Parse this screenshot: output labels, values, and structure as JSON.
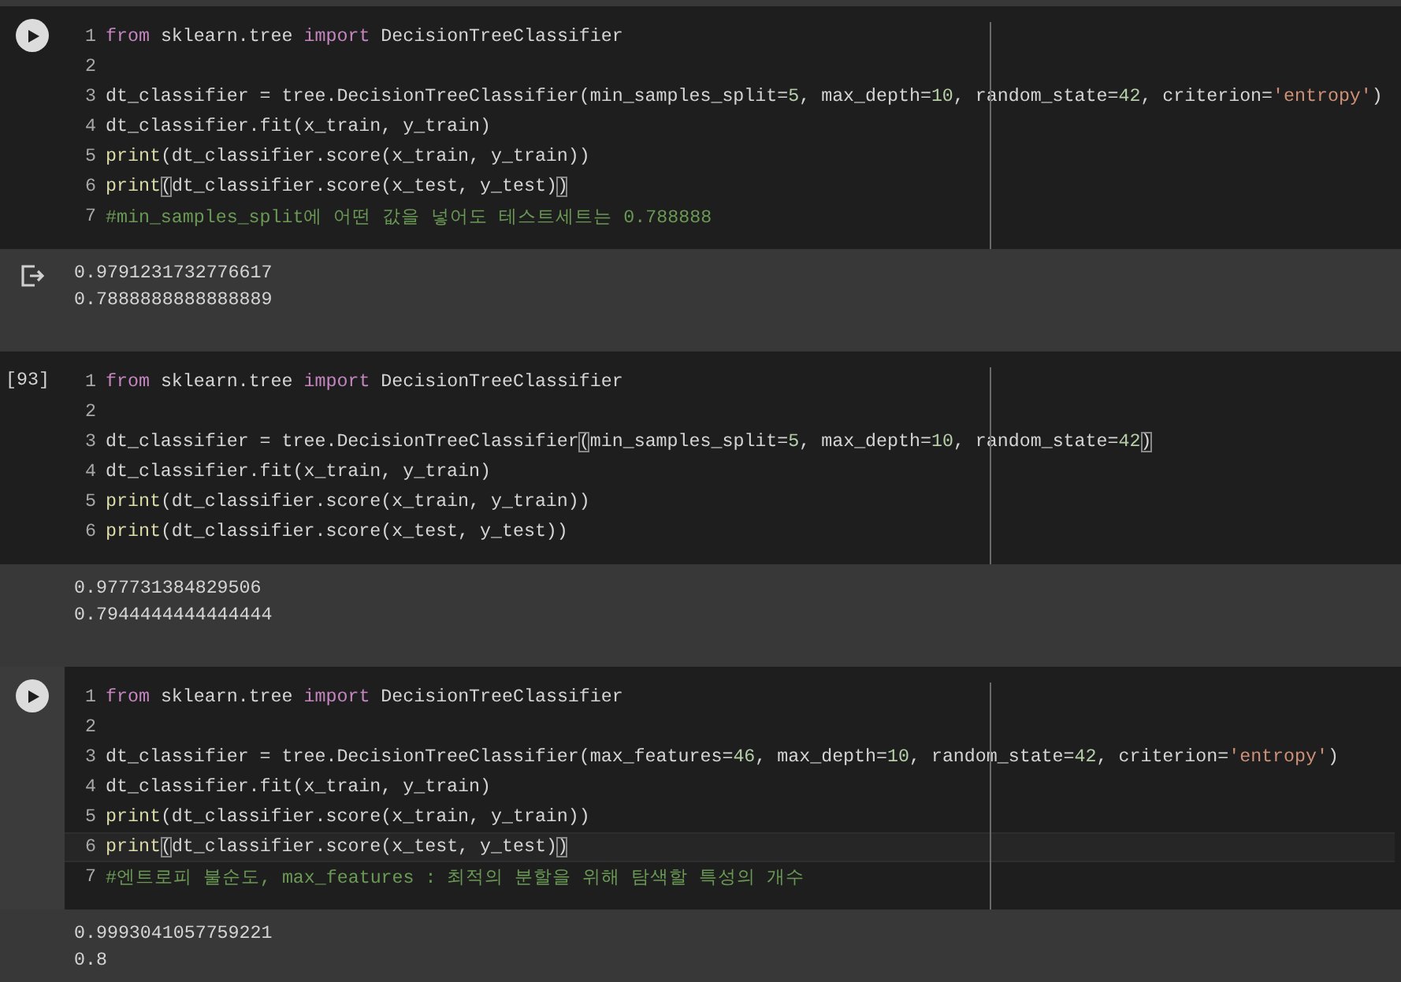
{
  "cells": [
    {
      "selected": false,
      "gutter": {
        "kind": "run"
      },
      "lines": [
        {
          "number": "1",
          "current": false,
          "tokens": [
            {
              "kind": "keyword",
              "text": "from"
            },
            {
              "kind": "plain",
              "text": " sklearn.tree "
            },
            {
              "kind": "keyword",
              "text": "import"
            },
            {
              "kind": "plain",
              "text": " DecisionTreeClassifier"
            }
          ]
        },
        {
          "number": "2",
          "current": false
        },
        {
          "number": "3",
          "current": false,
          "tokens": [
            {
              "kind": "plain",
              "text": "dt_classifier = tree.DecisionTreeClassifier(min_samples_split="
            },
            {
              "kind": "number",
              "text": "5"
            },
            {
              "kind": "plain",
              "text": ", max_depth="
            },
            {
              "kind": "number",
              "text": "10"
            },
            {
              "kind": "plain",
              "text": ", random_state="
            },
            {
              "kind": "number",
              "text": "42"
            },
            {
              "kind": "plain",
              "text": ", criterion="
            },
            {
              "kind": "string",
              "text": "'entropy'"
            },
            {
              "kind": "plain",
              "text": ")"
            }
          ]
        },
        {
          "number": "4",
          "current": false,
          "tokens": [
            {
              "kind": "plain",
              "text": "dt_classifier.fit(x_train, y_train)"
            }
          ]
        },
        {
          "number": "5",
          "current": false,
          "tokens": [
            {
              "kind": "builtin",
              "text": "print"
            },
            {
              "kind": "plain",
              "text": "(dt_classifier.score(x_train, y_train))"
            }
          ]
        },
        {
          "number": "6",
          "current": false,
          "tokens": [
            {
              "kind": "builtin",
              "text": "print"
            },
            {
              "kind": "match",
              "text": "("
            },
            {
              "kind": "plain",
              "text": "dt_classifier.score(x_test, y_test)"
            },
            {
              "kind": "match",
              "text": ")"
            }
          ]
        },
        {
          "number": "7",
          "current": false,
          "tokens": [
            {
              "kind": "comment",
              "text": "#min_samples_split에 어떤 값을 넣어도 테스트세트는 0.788888"
            }
          ]
        }
      ],
      "output": {
        "icon": true,
        "lines": [
          "0.9791231732776617",
          "0.7888888888888889"
        ]
      }
    },
    {
      "selected": false,
      "gutter": {
        "kind": "count",
        "label": "[93]"
      },
      "lines": [
        {
          "number": "1",
          "current": false,
          "tokens": [
            {
              "kind": "keyword",
              "text": "from"
            },
            {
              "kind": "plain",
              "text": " sklearn.tree "
            },
            {
              "kind": "keyword",
              "text": "import"
            },
            {
              "kind": "plain",
              "text": " DecisionTreeClassifier"
            }
          ]
        },
        {
          "number": "2",
          "current": false
        },
        {
          "number": "3",
          "current": false,
          "tokens": [
            {
              "kind": "plain",
              "text": "dt_classifier = tree.DecisionTreeClassifier"
            },
            {
              "kind": "match",
              "text": "("
            },
            {
              "kind": "plain",
              "text": "min_samples_split="
            },
            {
              "kind": "number",
              "text": "5"
            },
            {
              "kind": "plain",
              "text": ", max_depth="
            },
            {
              "kind": "number",
              "text": "10"
            },
            {
              "kind": "plain",
              "text": ", random_state="
            },
            {
              "kind": "number",
              "text": "42"
            },
            {
              "kind": "match",
              "text": ")"
            }
          ]
        },
        {
          "number": "4",
          "current": false,
          "tokens": [
            {
              "kind": "plain",
              "text": "dt_classifier.fit(x_train, y_train)"
            }
          ]
        },
        {
          "number": "5",
          "current": false,
          "tokens": [
            {
              "kind": "builtin",
              "text": "print"
            },
            {
              "kind": "plain",
              "text": "(dt_classifier.score(x_train, y_train))"
            }
          ]
        },
        {
          "number": "6",
          "current": false,
          "tokens": [
            {
              "kind": "builtin",
              "text": "print"
            },
            {
              "kind": "plain",
              "text": "(dt_classifier.score(x_test, y_test))"
            }
          ]
        }
      ],
      "output": {
        "icon": false,
        "lines": [
          "0.977731384829506",
          "0.7944444444444444"
        ]
      }
    },
    {
      "selected": true,
      "gutter": {
        "kind": "run"
      },
      "lines": [
        {
          "number": "1",
          "current": false,
          "tokens": [
            {
              "kind": "keyword",
              "text": "from"
            },
            {
              "kind": "plain",
              "text": " sklearn.tree "
            },
            {
              "kind": "keyword",
              "text": "import"
            },
            {
              "kind": "plain",
              "text": " DecisionTreeClassifier"
            }
          ]
        },
        {
          "number": "2",
          "current": false
        },
        {
          "number": "3",
          "current": false,
          "tokens": [
            {
              "kind": "plain",
              "text": "dt_classifier = tree.DecisionTreeClassifier(max_features="
            },
            {
              "kind": "number",
              "text": "46"
            },
            {
              "kind": "plain",
              "text": ", max_depth="
            },
            {
              "kind": "number",
              "text": "10"
            },
            {
              "kind": "plain",
              "text": ", random_state="
            },
            {
              "kind": "number",
              "text": "42"
            },
            {
              "kind": "plain",
              "text": ", criterion="
            },
            {
              "kind": "string",
              "text": "'entropy'"
            },
            {
              "kind": "plain",
              "text": ")"
            }
          ]
        },
        {
          "number": "4",
          "current": false,
          "tokens": [
            {
              "kind": "plain",
              "text": "dt_classifier.fit(x_train, y_train)"
            }
          ]
        },
        {
          "number": "5",
          "current": false,
          "tokens": [
            {
              "kind": "builtin",
              "text": "print"
            },
            {
              "kind": "plain",
              "text": "(dt_classifier.score(x_train, y_train))"
            }
          ]
        },
        {
          "number": "6",
          "current": true,
          "tokens": [
            {
              "kind": "builtin",
              "text": "print"
            },
            {
              "kind": "match",
              "text": "("
            },
            {
              "kind": "plain",
              "text": "dt_classifier.score(x_test, y_test)"
            },
            {
              "kind": "match",
              "text": ")"
            }
          ]
        },
        {
          "number": "7",
          "current": false,
          "tokens": [
            {
              "kind": "comment",
              "text": "#엔트로피 불순도, max_features : 최적의 분할을 위해 탐색할 특성의 개수"
            }
          ]
        }
      ],
      "output": {
        "icon": false,
        "lines": [
          "0.9993041057759221",
          "0.8"
        ]
      }
    }
  ]
}
